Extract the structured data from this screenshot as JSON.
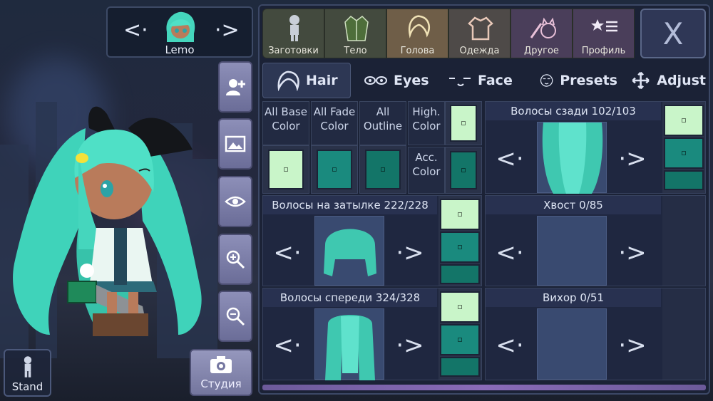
{
  "character": {
    "name": "Lemo",
    "prev_label": "<·",
    "next_label": "·>"
  },
  "tools": [
    {
      "icon": "add-user-icon"
    },
    {
      "icon": "image-icon"
    },
    {
      "icon": "eye-icon"
    },
    {
      "icon": "zoom-in-icon"
    },
    {
      "icon": "zoom-out-icon"
    }
  ],
  "stand": {
    "label": "Stand"
  },
  "studio": {
    "label": "Студия"
  },
  "top_tabs": [
    {
      "label": "Заготовки",
      "icon": "body-preset-icon"
    },
    {
      "label": "Тело",
      "icon": "jacket-icon"
    },
    {
      "label": "Голова",
      "icon": "hair-head-icon",
      "active": true
    },
    {
      "label": "Одежда",
      "icon": "shirt-icon"
    },
    {
      "label": "Другое",
      "icon": "sword-cat-icon"
    },
    {
      "label": "Профиль",
      "icon": "star-list-icon"
    }
  ],
  "close_label": "X",
  "sub_tabs": [
    {
      "label": "Hair",
      "icon": "hair-icon",
      "active": true
    },
    {
      "label": "Eyes",
      "icon": "eyes-icon"
    },
    {
      "label": "Face",
      "icon": "face-icon"
    },
    {
      "label": "Presets",
      "icon": "presets-icon"
    },
    {
      "label": "Adjust",
      "icon": "adjust-icon"
    }
  ],
  "color_buttons": {
    "all_base": "All Base Color",
    "all_fade": "All Fade Color",
    "all_outline": "All Outline",
    "high_color": "High. Color",
    "acc_color": "Acc. Color"
  },
  "colors": {
    "mint": "#c9f5c9",
    "teal": "#2bb3a0",
    "teal_dark": "#1a8a7e",
    "teal_deep": "#137568",
    "accent": "#6f5e48"
  },
  "parts": {
    "back_hair": {
      "title": "Волосы сзади 102/103",
      "prev": "<·",
      "next": "·>"
    },
    "nape_hair": {
      "title": "Волосы на затылке 222/228",
      "prev": "<·",
      "next": "·>"
    },
    "tail": {
      "title": "Хвост 0/85",
      "prev": "<·",
      "next": "·>"
    },
    "front_hair": {
      "title": "Волосы спереди 324/328",
      "prev": "<·",
      "next": "·>"
    },
    "ahoge": {
      "title": "Вихор 0/51",
      "prev": "<·",
      "next": "·>"
    }
  }
}
